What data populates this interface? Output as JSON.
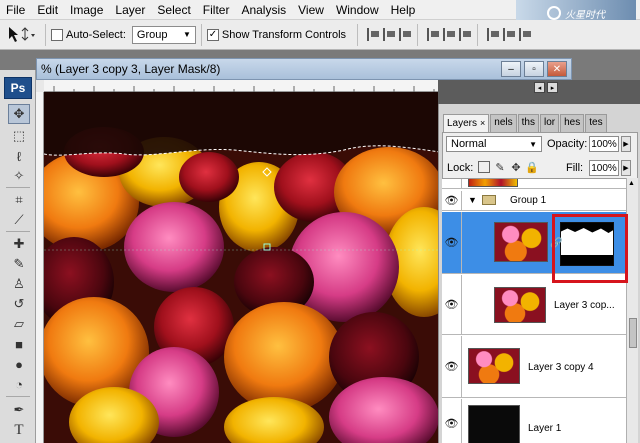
{
  "menu": [
    "File",
    "Edit",
    "Image",
    "Layer",
    "Select",
    "Filter",
    "Analysis",
    "View",
    "Window",
    "Help"
  ],
  "logo_text": "火星时代",
  "options": {
    "auto_select_label": "Auto-Select:",
    "auto_select_checked": false,
    "auto_select_value": "Group",
    "show_transform_label": "Show Transform Controls",
    "show_transform_checked": true
  },
  "toolbox": {
    "app_badge": "Ps",
    "tools": [
      "move-tool",
      "marquee-tool",
      "lasso-tool",
      "magic-wand-tool",
      "crop-tool",
      "slice-tool",
      "healing-brush-tool",
      "brush-tool",
      "clone-stamp-tool",
      "history-brush-tool",
      "eraser-tool",
      "gradient-tool",
      "blur-tool",
      "dodge-tool",
      "pen-tool",
      "type-tool"
    ]
  },
  "document": {
    "title": "% (Layer 3 copy 3, Layer Mask/8)",
    "buttons": {
      "minimize": "–",
      "restore": "▫",
      "close": "✕"
    }
  },
  "panel": {
    "tabs": [
      {
        "label": "Layers",
        "active": true,
        "close": "×"
      },
      {
        "label": "nels",
        "active": false
      },
      {
        "label": "ths",
        "active": false
      },
      {
        "label": "lor",
        "active": false
      },
      {
        "label": "hes",
        "active": false
      },
      {
        "label": "tes",
        "active": false
      }
    ],
    "blend_mode": "Normal",
    "opacity_label": "Opacity:",
    "opacity_value": "100%",
    "lock_label": "Lock:",
    "fill_label": "Fill:",
    "fill_value": "100%",
    "layers": [
      {
        "name": "",
        "type": "roses-partial"
      },
      {
        "name": "Group 1",
        "type": "group"
      },
      {
        "name": "",
        "type": "roses-masked",
        "selected": true
      },
      {
        "name": "Layer 3 cop...",
        "type": "roses"
      },
      {
        "name": "Layer 3 copy 4",
        "type": "roses"
      },
      {
        "name": "Layer 1",
        "type": "black"
      }
    ]
  }
}
